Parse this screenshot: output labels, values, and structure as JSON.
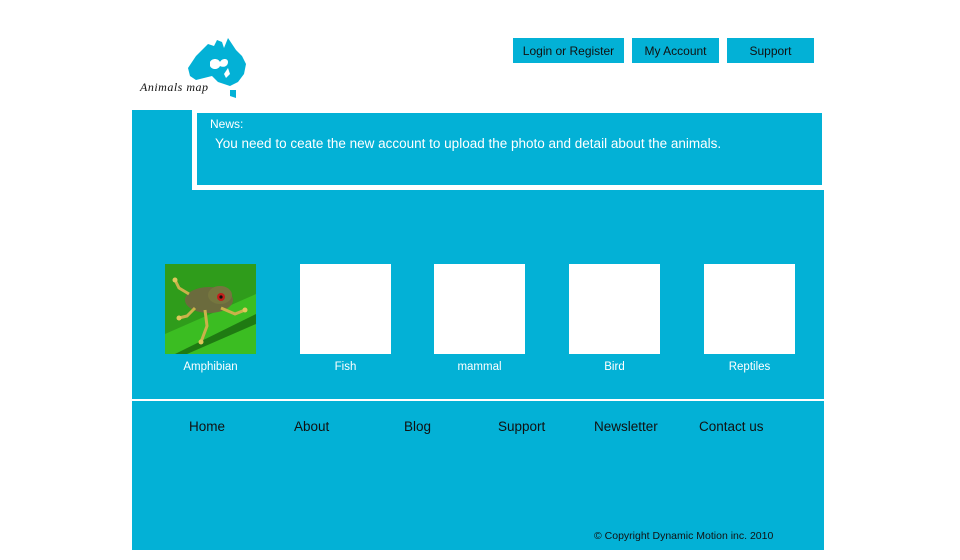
{
  "logo": {
    "text": "Animals  map",
    "icon": "australia-map-icon"
  },
  "top_nav": {
    "login_label": "Login or  Register",
    "account_label": "My Account",
    "support_label": "Support"
  },
  "news": {
    "title": "News:",
    "text": "You need to ceate the new account to  upload the photo and detail about the animals."
  },
  "categories": [
    {
      "label": "Amphibian",
      "image": "frog-photo"
    },
    {
      "label": "Fish",
      "image": "placeholder"
    },
    {
      "label": "mammal",
      "image": "placeholder"
    },
    {
      "label": "Bird",
      "image": "placeholder"
    },
    {
      "label": "Reptiles",
      "image": "placeholder"
    }
  ],
  "footer": {
    "links": [
      "Home",
      "About",
      "Blog",
      "Support",
      "Newsletter",
      "Contact us"
    ],
    "copyright": "© Copyright Dynamic Motion inc. 2010"
  },
  "colors": {
    "accent": "#03b1d6",
    "background": "#ffffff",
    "text_dark": "#111111"
  }
}
